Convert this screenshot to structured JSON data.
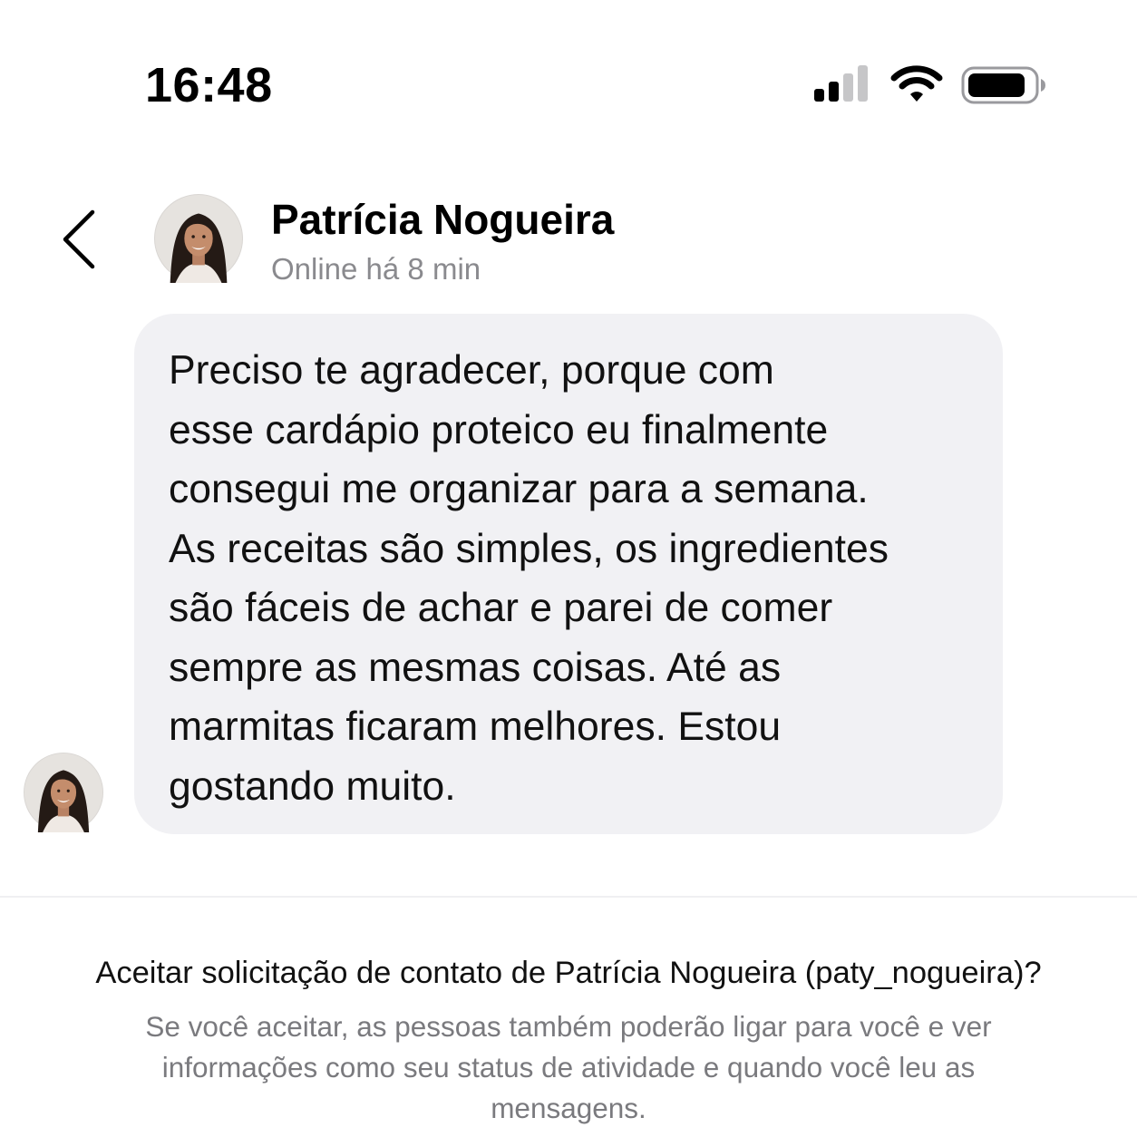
{
  "status_bar": {
    "time": "16:48",
    "icons": [
      "cellular-signal-icon",
      "wifi-icon",
      "battery-icon"
    ]
  },
  "header": {
    "back_icon": "chevron-left-icon",
    "avatar": "profile-photo",
    "contact_name": "Patrícia Nogueira",
    "contact_status": "Online há 8 min"
  },
  "conversation": {
    "messages": [
      {
        "sender_avatar": "profile-photo",
        "lines": [
          "Preciso te agradecer, porque com",
          "esse cardápio proteico eu finalmente",
          "consegui me organizar para a semana.",
          "As receitas são simples, os ingredientes",
          "são fáceis de achar e parei de comer",
          "sempre as mesmas coisas. Até as",
          "marmitas ficaram melhores. Estou",
          "gostando muito."
        ]
      }
    ]
  },
  "request": {
    "question": "Aceitar solicitação de contato de Patrícia Nogueira (paty_nogueira)?",
    "explanation_lines": [
      "Se você aceitar, as pessoas também poderão ligar para você e ver",
      "informações como seu status de atividade e quando você leu as",
      "mensagens."
    ]
  },
  "colors": {
    "background": "#ffffff",
    "bubble": "#f1f1f4",
    "secondary_text": "#8a8a8e"
  }
}
